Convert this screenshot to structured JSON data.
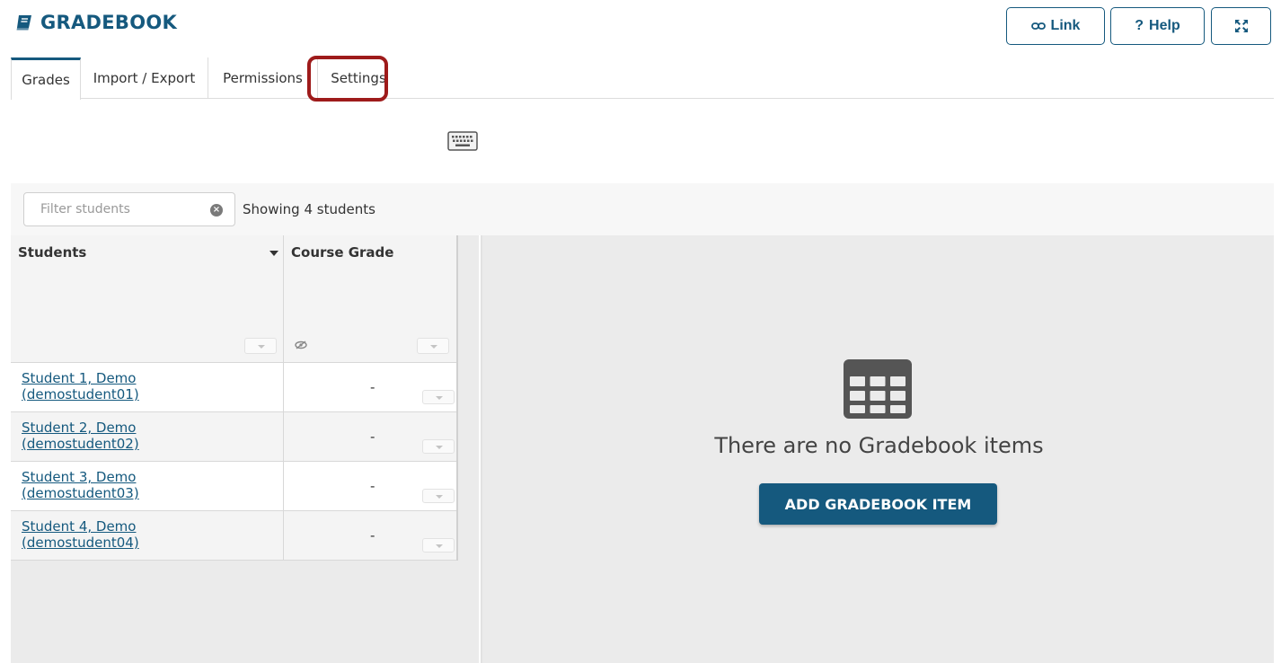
{
  "header": {
    "title": "GRADEBOOK",
    "icon": "book-icon"
  },
  "toolbar": {
    "link_label": "Link",
    "help_label": "Help",
    "expand_icon": "expand-icon"
  },
  "tabs": [
    {
      "label": "Grades",
      "active": true
    },
    {
      "label": "Import / Export",
      "active": false
    },
    {
      "label": "Permissions",
      "active": false
    },
    {
      "label": "Settings",
      "active": false,
      "highlighted": true
    }
  ],
  "filter": {
    "placeholder": "Filter students",
    "status": "Showing 4 students"
  },
  "grid": {
    "columns": {
      "students": "Students",
      "course_grade": "Course Grade"
    },
    "rows": [
      {
        "name": "Student 1, Demo",
        "id": "(demostudent01)",
        "grade": "-"
      },
      {
        "name": "Student 2, Demo",
        "id": "(demostudent02)",
        "grade": "-"
      },
      {
        "name": "Student 3, Demo",
        "id": "(demostudent03)",
        "grade": "-"
      },
      {
        "name": "Student 4, Demo",
        "id": "(demostudent04)",
        "grade": "-"
      }
    ]
  },
  "empty": {
    "message": "There are no Gradebook items",
    "add_button": "ADD GRADEBOOK ITEM"
  },
  "colors": {
    "brand": "#15597e",
    "highlight": "#9e1b1b"
  }
}
